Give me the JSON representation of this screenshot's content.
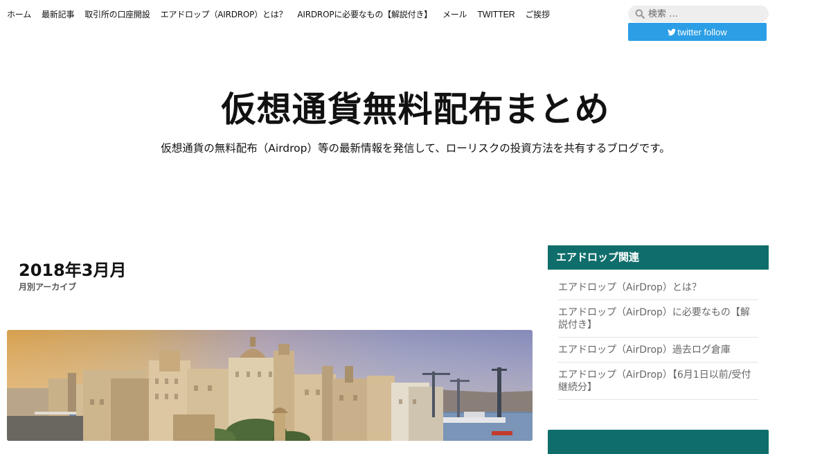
{
  "nav": {
    "items": [
      {
        "label": "ホーム"
      },
      {
        "label": "最新記事"
      },
      {
        "label": "取引所の口座開設"
      },
      {
        "label": "エアドロップ（AIRDROP）とは？"
      },
      {
        "label": "AIRDROPに必要なもの【解説付き】"
      },
      {
        "label": "メール"
      },
      {
        "label": "TWITTER"
      },
      {
        "label": "ご挨拶"
      }
    ]
  },
  "search": {
    "placeholder": "検索 …",
    "icon": "search-icon"
  },
  "twitter_button": {
    "label": "twitter follow",
    "icon": "twitter-bird-icon",
    "color": "#2b9ee6"
  },
  "header": {
    "title": "仮想通貨無料配布まとめ",
    "description": "仮想通貨の無料配布（Airdrop）等の最新情報を発信して、ローリスクの投資方法を共有するブログです。"
  },
  "archive": {
    "title": "2018年3月月",
    "subtitle": "月別アーカイブ"
  },
  "sidebar": {
    "accent_color": "#0f6e6b",
    "widget": {
      "title": "エアドロップ関連",
      "items": [
        {
          "label": "エアドロップ（AirDrop）とは？"
        },
        {
          "label": "エアドロップ（AirDrop）に必要なもの【解説付き】"
        },
        {
          "label": "エアドロップ（AirDrop）過去ログ倉庫"
        },
        {
          "label": "エアドロップ（AirDrop）【6月1日以前/受付継続分】"
        }
      ]
    }
  }
}
